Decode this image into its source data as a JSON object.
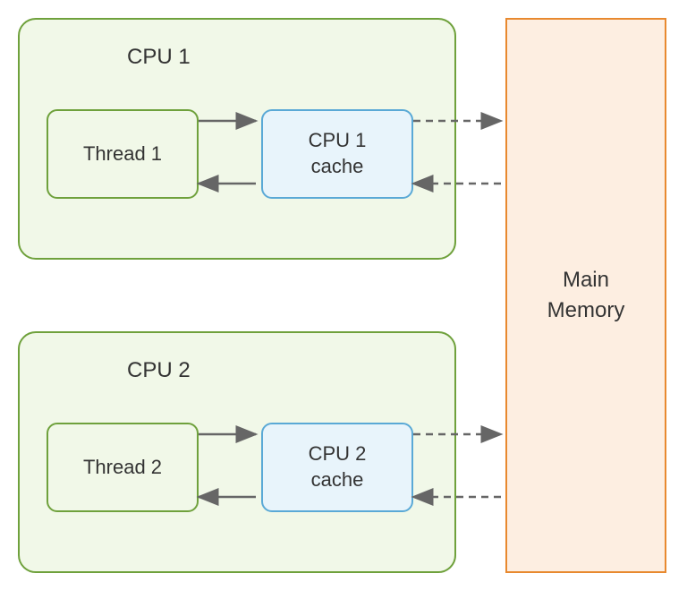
{
  "cpu1": {
    "title": "CPU 1",
    "thread": "Thread 1",
    "cache": "CPU 1\ncache"
  },
  "cpu2": {
    "title": "CPU 2",
    "thread": "Thread 2",
    "cache": "CPU 2\ncache"
  },
  "memory": "Main\nMemory",
  "colors": {
    "cpuBorder": "#6fa13c",
    "cpuFill": "#f1f8e8",
    "cacheBorder": "#5aa9d6",
    "cacheFill": "#e8f4fb",
    "memoryBorder": "#e8892f",
    "memoryFill": "#fdeee1",
    "arrow": "#666666"
  }
}
